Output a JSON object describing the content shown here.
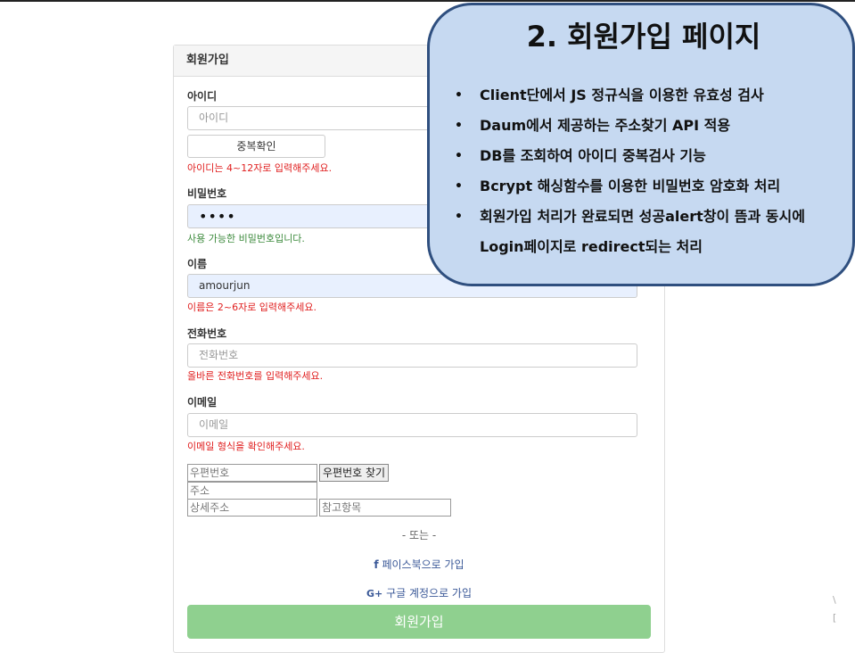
{
  "form": {
    "header": "회원가입",
    "id_label": "아이디",
    "id_placeholder": "아이디",
    "dup_check_button": "중복확인",
    "id_message": "아이디는 4~12자로 입력해주세요.",
    "pw_label": "비밀번호",
    "pw_value": "••••",
    "pw_message": "사용 가능한 비밀번호입니다.",
    "name_label": "이름",
    "name_value": "amourjun",
    "name_message": "이름은 2~6자로 입력해주세요.",
    "phone_label": "전화번호",
    "phone_placeholder": "전화번호",
    "phone_message": "올바른 전화번호를 입력해주세요.",
    "email_label": "이메일",
    "email_placeholder": "이메일",
    "email_message": "이메일 형식을 확인해주세요.",
    "postcode_placeholder": "우편번호",
    "postcode_button": "우편번호 찾기",
    "address_placeholder": "주소",
    "detail_address_placeholder": "상세주소",
    "extra_address_placeholder": "참고항목",
    "or_text": "- 또는 -",
    "facebook_icon": "f",
    "facebook_label": "페이스북으로 가입",
    "google_icon": "G+",
    "google_label": "구글 계정으로 가입",
    "submit_button": "회원가입"
  },
  "callout": {
    "title": "2. 회원가입 페이지",
    "items": [
      "Client단에서 JS 정규식을 이용한 유효성 검사",
      "Daum에서 제공하는 주소찾기 API 적용",
      "DB를 조회하여 아이디 중복검사 기능",
      "Bcrypt 해싱함수를 이용한 비밀번호 암호화 처리",
      "회원가입 처리가 완료되면 성공alert창이 뜸과 동시에 Login페이지로 redirect되는 처리"
    ]
  },
  "edge_marks": [
    "\\",
    "["
  ],
  "colors": {
    "error": "#e02020",
    "success": "#3c8a3c",
    "submit_bg": "#8fd08f",
    "callout_bg": "#c6d9f1",
    "callout_border": "#2f4f7f"
  }
}
